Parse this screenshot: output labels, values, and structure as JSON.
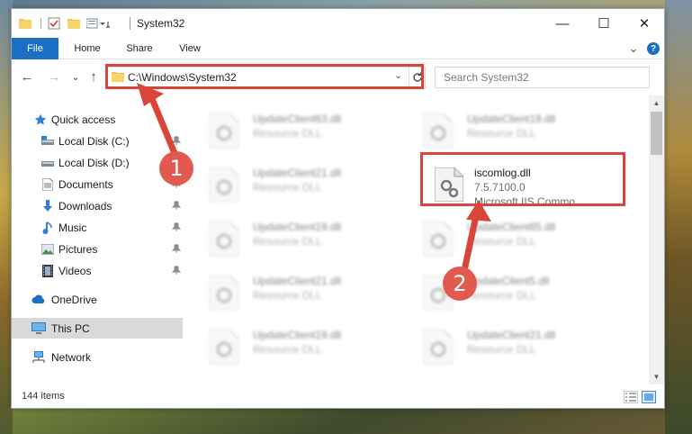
{
  "window": {
    "title": "System32",
    "controls": {
      "minimize": "—",
      "maximize": "☐",
      "close": "✕"
    }
  },
  "ribbon": {
    "tabs": [
      "File",
      "Home",
      "Share",
      "View"
    ],
    "collapse_glyph": "⌄",
    "help_glyph": "?"
  },
  "address": {
    "path": "C:\\Windows\\System32",
    "dropdown_glyph": "⌄",
    "search_placeholder": "Search System32"
  },
  "nav": {
    "back": "←",
    "forward": "→",
    "recent": "⌄",
    "up": "↑"
  },
  "sidebar": {
    "items": [
      {
        "label": "Quick access",
        "icon": "star-icon"
      },
      {
        "label": "Local Disk (C:)",
        "icon": "drive-icon",
        "pinned": true
      },
      {
        "label": "Local Disk (D:)",
        "icon": "drive-icon",
        "pinned": false
      },
      {
        "label": "Documents",
        "icon": "documents-icon",
        "pinned": true
      },
      {
        "label": "Downloads",
        "icon": "download-icon",
        "pinned": true
      },
      {
        "label": "Music",
        "icon": "music-icon",
        "pinned": true
      },
      {
        "label": "Pictures",
        "icon": "pictures-icon",
        "pinned": true
      },
      {
        "label": "Videos",
        "icon": "videos-icon",
        "pinned": true
      },
      {
        "label": "OneDrive",
        "icon": "cloud-icon"
      },
      {
        "label": "This PC",
        "icon": "computer-icon",
        "selected": true
      },
      {
        "label": "Network",
        "icon": "network-icon"
      }
    ]
  },
  "files": [
    {
      "name": "UpdateClient63.dll",
      "desc": "Resource DLL",
      "blurred": true
    },
    {
      "name": "UpdateClient19.dll",
      "desc": "Resource DLL",
      "blurred": true
    },
    {
      "name": "UpdateClient21.dll",
      "desc": "Resource DLL",
      "blurred": true
    },
    {
      "name": "iscomlog.dll",
      "desc": "7.5.7100.0",
      "desc2": "Microsoft IIS Commo...",
      "blurred": false
    },
    {
      "name": "UpdateClient19.dll",
      "desc": "Resource DLL",
      "blurred": true
    },
    {
      "name": "UpdateClient65.dll",
      "desc": "Resource DLL",
      "blurred": true
    },
    {
      "name": "UpdateClient21.dll",
      "desc": "Resource DLL",
      "blurred": true
    },
    {
      "name": "UpdateClient5.dll",
      "desc": "Resource DLL",
      "blurred": true
    },
    {
      "name": "UpdateClient19.dll",
      "desc": "Resource DLL",
      "blurred": true
    },
    {
      "name": "UpdateClient21.dll",
      "desc": "Resource DLL",
      "blurred": true
    }
  ],
  "status": {
    "item_count": "144 items"
  },
  "annotations": {
    "step1": "1",
    "step2": "2",
    "color": "#d9453b"
  }
}
